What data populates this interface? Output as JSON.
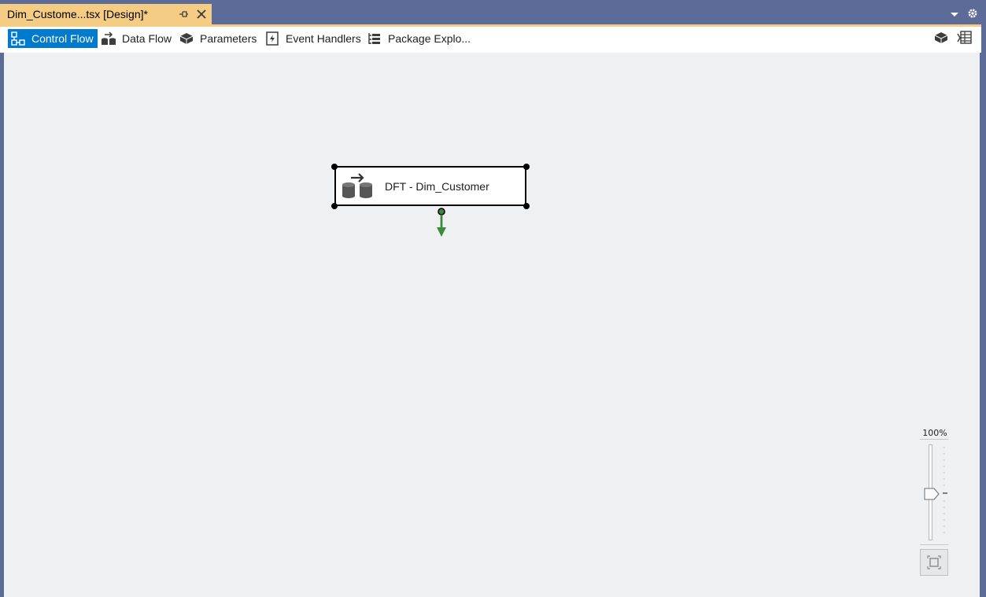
{
  "document_tab": {
    "title": "Dim_Custome...tsx [Design]*"
  },
  "toolbar": {
    "tabs": [
      {
        "label": "Control Flow",
        "icon": "control-flow-icon",
        "active": true
      },
      {
        "label": "Data Flow",
        "icon": "data-flow-icon",
        "active": false
      },
      {
        "label": "Parameters",
        "icon": "parameters-icon",
        "active": false
      },
      {
        "label": "Event Handlers",
        "icon": "event-handlers-icon",
        "active": false
      },
      {
        "label": "Package Explo...",
        "icon": "package-explorer-icon",
        "active": false
      }
    ],
    "right_icons": [
      "package-icon",
      "variables-icon"
    ]
  },
  "canvas": {
    "task": {
      "label": "DFT - Dim_Customer",
      "icon": "data-flow-task-icon"
    },
    "connector_color": "#3c8a3c"
  },
  "zoom": {
    "level": "100%",
    "percent": 100
  },
  "colors": {
    "accent": "#007acc",
    "tab_highlight": "#f5cc84",
    "frame": "#5d6b99",
    "canvas": "#eff0f2"
  }
}
